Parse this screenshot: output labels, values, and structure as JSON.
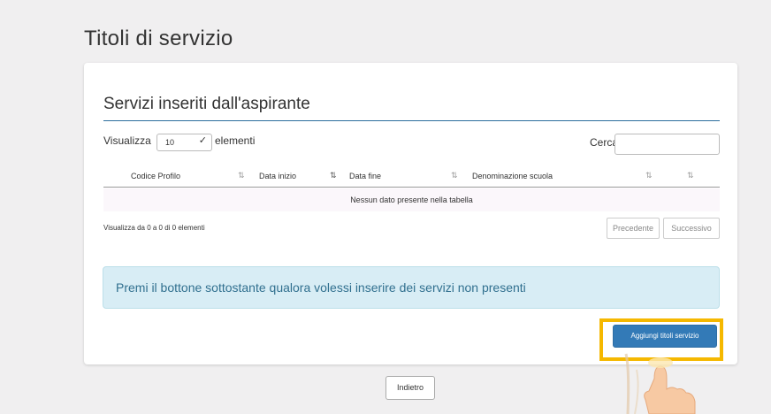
{
  "page": {
    "title": "Titoli di servizio"
  },
  "card": {
    "title": "Servizi inseriti dall'aspirante"
  },
  "controls": {
    "length_prefix": "Visualizza",
    "length_value": "10",
    "length_suffix": "elementi",
    "search_label": "Cerca:",
    "search_value": ""
  },
  "table": {
    "headers": [
      "Codice Profilo",
      "Data inizio",
      "Data fine",
      "Denominazione scuola",
      "",
      ""
    ],
    "empty_message": "Nessun dato presente nella tabella"
  },
  "pagination": {
    "info": "Visualizza da 0 a 0 di 0 elementi",
    "prev": "Precedente",
    "next": "Successivo"
  },
  "alert": {
    "text": "Premi il bottone sottostante qualora volessi inserire dei servizi non presenti"
  },
  "actions": {
    "add": "Aggiungi titoli servizio",
    "back": "Indietro"
  },
  "colors": {
    "primary": "#337ab7",
    "highlight": "#f5b800",
    "alert_bg": "#d8edf5",
    "alert_text": "#31708f"
  }
}
